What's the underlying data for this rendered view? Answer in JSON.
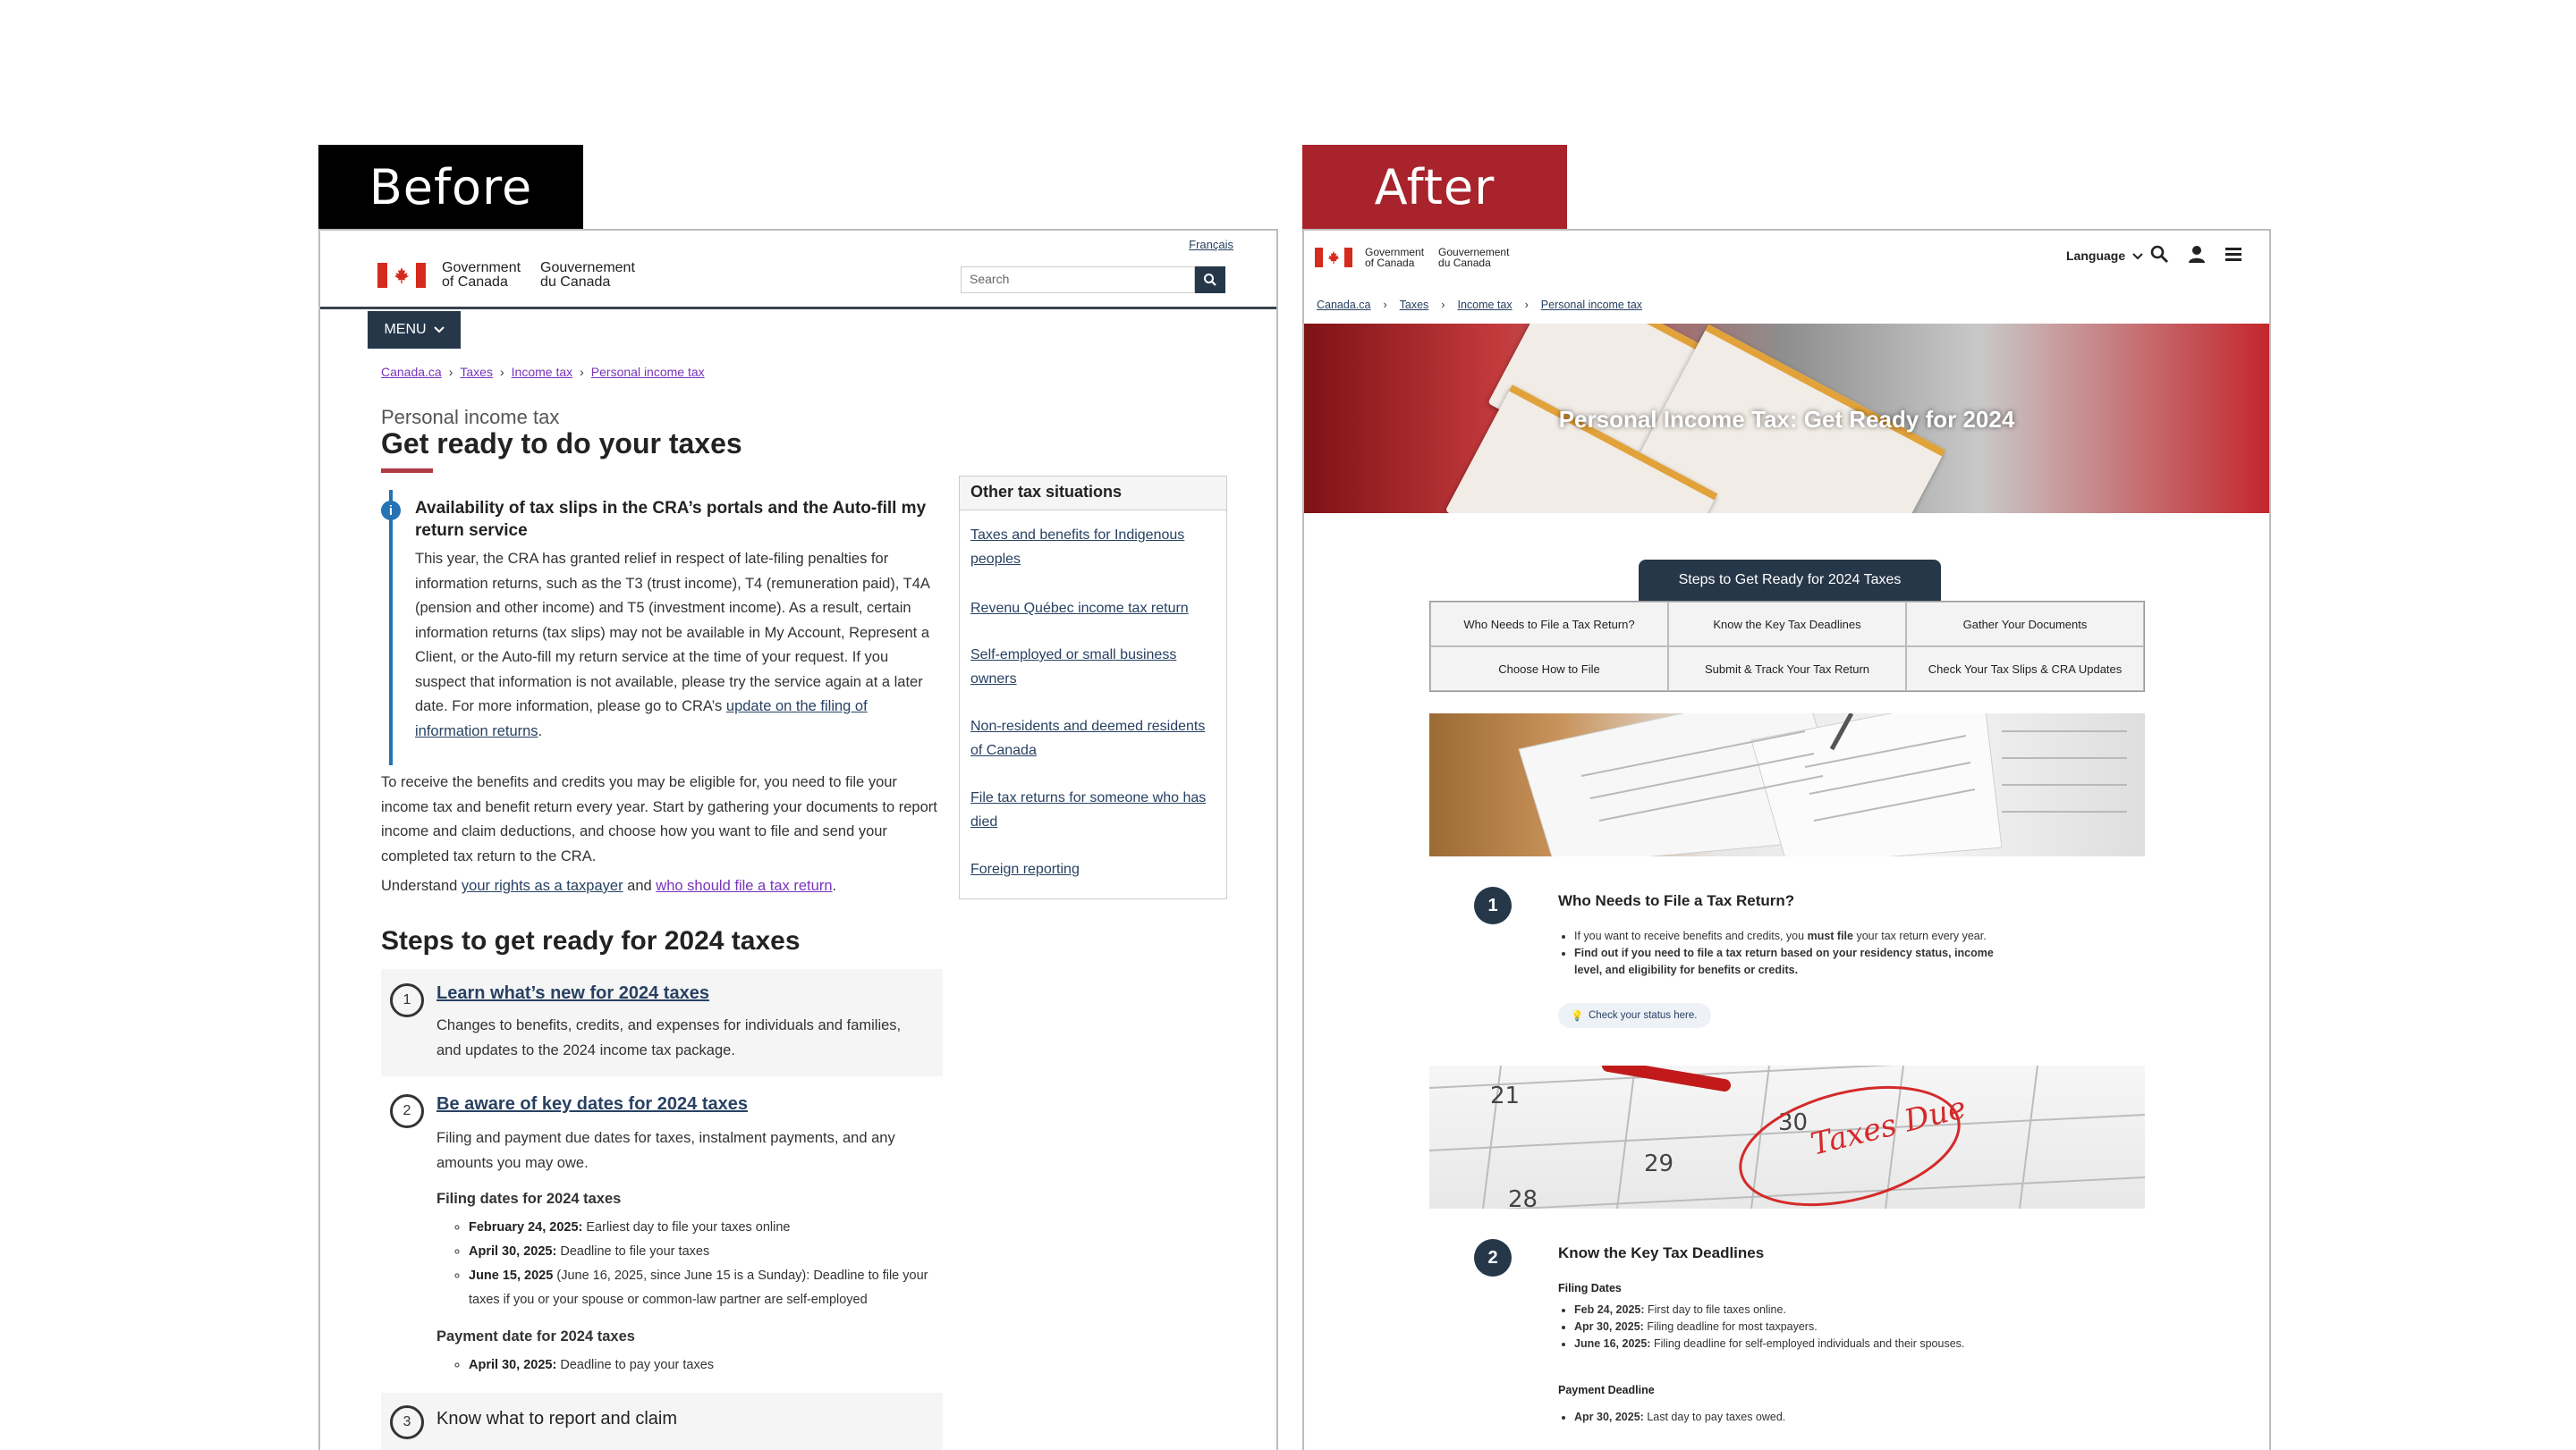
{
  "labels": {
    "before": "Before",
    "after": "After"
  },
  "colors": {
    "goc_navy": "#26374a",
    "goc_red": "#d52b1e",
    "after_label": "#a8232b",
    "link": "#284162",
    "visited": "#7834bc"
  },
  "before": {
    "francais": "Français",
    "signature": {
      "en1": "Government",
      "en2": "of Canada",
      "fr1": "Gouvernement",
      "fr2": "du Canada"
    },
    "search_placeholder": "Search",
    "menu_label": "MENU",
    "breadcrumb": [
      "Canada.ca",
      "Taxes",
      "Income tax",
      "Personal income tax"
    ],
    "pre_title": "Personal income tax",
    "title": "Get ready to do your taxes",
    "alert": {
      "title": "Availability of tax slips in the CRA’s portals and the Auto-fill my return service",
      "body": "This year, the CRA has granted relief in respect of late-filing penalties for information returns, such as the T3 (trust income), T4 (remuneration paid), T4A (pension and other income) and T5 (investment income). As a result, certain information returns (tax slips) may not be available in My Account, Represent a Client, or the Auto-fill my return service at the time of your request. If you suspect that information is not available, please try the service again at a later date. For more information, please go to CRA’s",
      "link": "update on the filing of information returns",
      "end": "."
    },
    "intro": "To receive the benefits and credits you may be eligible for, you need to file your income tax and benefit return every year. Start by gathering your documents to report income and claim deductions, and choose how you want to file and send your completed tax return to the CRA.",
    "understand": {
      "prefix": "Understand",
      "link1": "your rights as a taxpayer",
      "mid": "and",
      "link2": "who should file a tax return",
      "end": "."
    },
    "steps_heading": "Steps to get ready for 2024 taxes",
    "steps": [
      {
        "num": "1",
        "title": "Learn what’s new for 2024 taxes",
        "desc": "Changes to benefits, credits, and expenses for individuals and families, and updates to the 2024 income tax package."
      },
      {
        "num": "2",
        "title": "Be aware of key dates for 2024 taxes",
        "desc": "Filing and payment due dates for taxes, instalment payments, and any amounts you may owe.",
        "filing_heading": "Filing dates for 2024 taxes",
        "filing": [
          {
            "date": "February 24, 2025:",
            "text": "Earliest day to file your taxes online"
          },
          {
            "date": "April 30, 2025:",
            "text": "Deadline to file your taxes"
          },
          {
            "date": "June 15, 2025",
            "text": "(June 16, 2025, since June 15 is a Sunday): Deadline to file your taxes if you or your spouse or common-law partner are self-employed"
          }
        ],
        "payment_heading": "Payment date for 2024 taxes",
        "payment": [
          {
            "date": "April 30, 2025:",
            "text": "Deadline to pay your taxes"
          }
        ]
      },
      {
        "num": "3",
        "title": "Know what to report and claim"
      }
    ],
    "aside": {
      "title": "Other tax situations",
      "links": [
        "Taxes and benefits for Indigenous peoples",
        "Revenu Québec income tax return",
        "Self-employed or small business owners",
        "Non-residents and deemed residents of Canada",
        "File tax returns for someone who has died",
        "Foreign reporting"
      ]
    }
  },
  "after": {
    "signature": {
      "en1": "Government",
      "en2": "of Canada",
      "fr1": "Gouvernement",
      "fr2": "du Canada"
    },
    "language": "Language",
    "breadcrumb": [
      "Canada.ca",
      "Taxes",
      "Income tax",
      "Personal income tax"
    ],
    "hero_title": "Personal Income Tax: Get Ready for 2024",
    "steps_tab": "Steps to Get Ready for 2024 Taxes",
    "grid": [
      "Who Needs to File a Tax Return?",
      "Know the Key Tax Deadlines",
      "Gather Your Documents",
      "Choose How to File",
      "Submit & Track Your Tax Return",
      "Check Your Tax Slips & CRA Updates"
    ],
    "section1": {
      "num": "1",
      "title": "Who Needs to File a Tax Return?",
      "bullet1_pre": "If you want to receive benefits and credits, you",
      "bullet1_bold": "must file",
      "bullet1_post": "your tax return every year.",
      "bullet2": "Find out if you need to file a tax return based on your residency status, income level, and eligibility for benefits or credits.",
      "check": "Check your status here."
    },
    "calendar_numbers": [
      "21",
      "29",
      "30",
      "28"
    ],
    "calendar_note": "Taxes Due",
    "section2": {
      "num": "2",
      "title": "Know the Key Tax Deadlines",
      "filing_heading": "Filing Dates",
      "filing": [
        {
          "date": "Feb 24, 2025:",
          "text": "First day to file taxes online."
        },
        {
          "date": "Apr 30, 2025:",
          "text": "Filing deadline for most taxpayers."
        },
        {
          "date": "June 16, 2025:",
          "text": "Filing deadline for self-employed individuals and their spouses."
        }
      ],
      "payment_heading": "Payment Deadline",
      "payment": [
        {
          "date": "Apr 30, 2025:",
          "text": "Last day to pay taxes owed."
        }
      ]
    }
  }
}
